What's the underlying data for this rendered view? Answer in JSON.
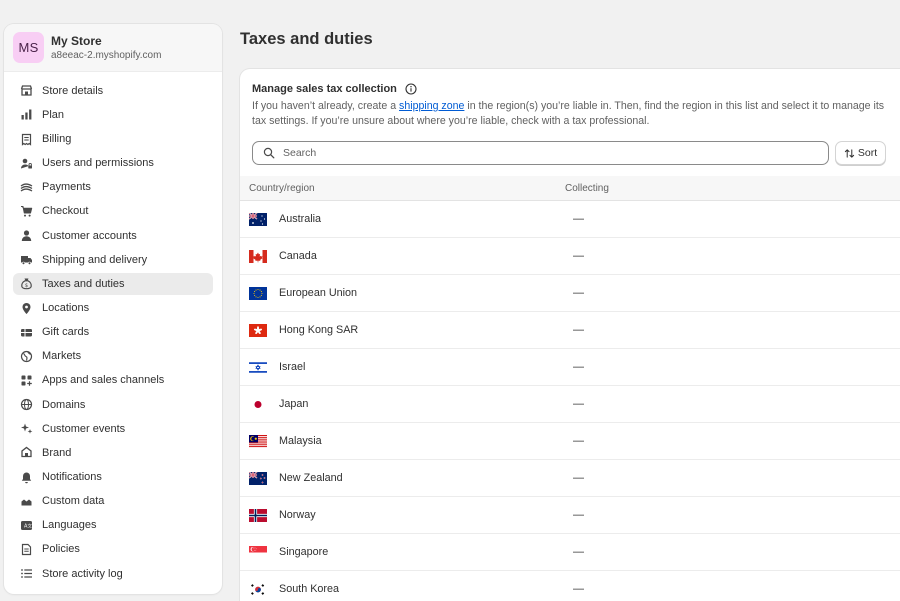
{
  "store": {
    "initials": "MS",
    "name": "My Store",
    "domain": "a8eeac-2.myshopify.com"
  },
  "nav": [
    {
      "label": "Store details",
      "icon": "store-icon"
    },
    {
      "label": "Plan",
      "icon": "chart-icon"
    },
    {
      "label": "Billing",
      "icon": "receipt-icon"
    },
    {
      "label": "Users and permissions",
      "icon": "person-lock-icon"
    },
    {
      "label": "Payments",
      "icon": "payment-icon"
    },
    {
      "label": "Checkout",
      "icon": "cart-icon"
    },
    {
      "label": "Customer accounts",
      "icon": "person-icon"
    },
    {
      "label": "Shipping and delivery",
      "icon": "truck-icon"
    },
    {
      "label": "Taxes and duties",
      "icon": "money-bag-icon",
      "active": true
    },
    {
      "label": "Locations",
      "icon": "location-icon"
    },
    {
      "label": "Gift cards",
      "icon": "gift-card-icon"
    },
    {
      "label": "Markets",
      "icon": "globe-icon"
    },
    {
      "label": "Apps and sales channels",
      "icon": "apps-icon"
    },
    {
      "label": "Domains",
      "icon": "domain-globe-icon"
    },
    {
      "label": "Customer events",
      "icon": "sparkle-icon"
    },
    {
      "label": "Brand",
      "icon": "brand-icon"
    },
    {
      "label": "Notifications",
      "icon": "bell-icon"
    },
    {
      "label": "Custom data",
      "icon": "database-icon"
    },
    {
      "label": "Languages",
      "icon": "language-icon"
    },
    {
      "label": "Policies",
      "icon": "document-icon"
    },
    {
      "label": "Store activity log",
      "icon": "list-icon"
    }
  ],
  "page": {
    "title": "Taxes and duties"
  },
  "card": {
    "title": "Manage sales tax collection",
    "desc_before": "If you haven’t already, create a ",
    "desc_link": "shipping zone",
    "desc_after": " in the region(s) you’re liable in. Then, find the region in this list and select it to manage its tax settings. If you’re unsure about where you’re liable, check with a tax professional.",
    "search_placeholder": "Search",
    "sort_label": "Sort"
  },
  "table": {
    "headers": {
      "country": "Country/region",
      "collecting": "Collecting"
    },
    "rows": [
      {
        "country": "Australia",
        "collecting": "—",
        "flag": "au"
      },
      {
        "country": "Canada",
        "collecting": "—",
        "flag": "ca"
      },
      {
        "country": "European Union",
        "collecting": "—",
        "flag": "eu"
      },
      {
        "country": "Hong Kong SAR",
        "collecting": "—",
        "flag": "hk"
      },
      {
        "country": "Israel",
        "collecting": "—",
        "flag": "il"
      },
      {
        "country": "Japan",
        "collecting": "—",
        "flag": "jp"
      },
      {
        "country": "Malaysia",
        "collecting": "—",
        "flag": "my"
      },
      {
        "country": "New Zealand",
        "collecting": "—",
        "flag": "nz"
      },
      {
        "country": "Norway",
        "collecting": "—",
        "flag": "no"
      },
      {
        "country": "Singapore",
        "collecting": "—",
        "flag": "sg"
      },
      {
        "country": "South Korea",
        "collecting": "—",
        "flag": "kr"
      }
    ]
  },
  "colors": {
    "link": "#005bd3",
    "avatar_bg": "#f8cef4",
    "active_nav": "#ebebeb"
  }
}
